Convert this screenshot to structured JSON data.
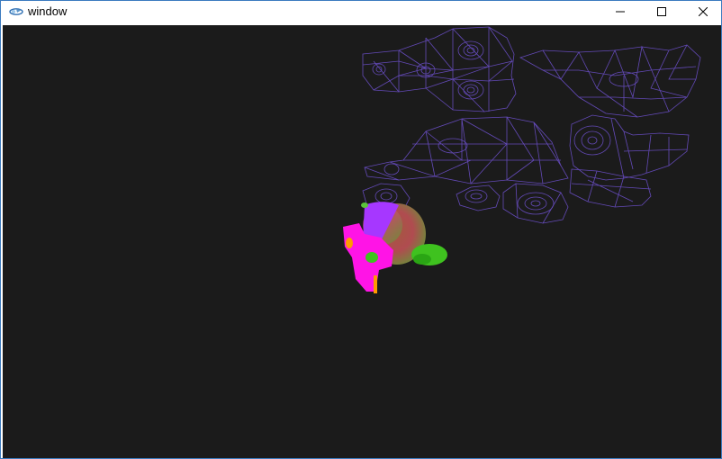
{
  "window": {
    "title": "window",
    "app_icon": "opengl-app-icon",
    "controls": {
      "minimize_icon": "minimize-icon",
      "maximize_icon": "maximize-icon",
      "close_icon": "close-icon"
    }
  },
  "colors": {
    "viewport_background": "#1b1b1b",
    "wireframe": "#6b4fc8",
    "model_magenta": "#ff14e6",
    "model_purple": "#a637ff",
    "model_green": "#3fc21f",
    "model_red": "#d84a4a",
    "model_orange": "#ff9a00"
  }
}
